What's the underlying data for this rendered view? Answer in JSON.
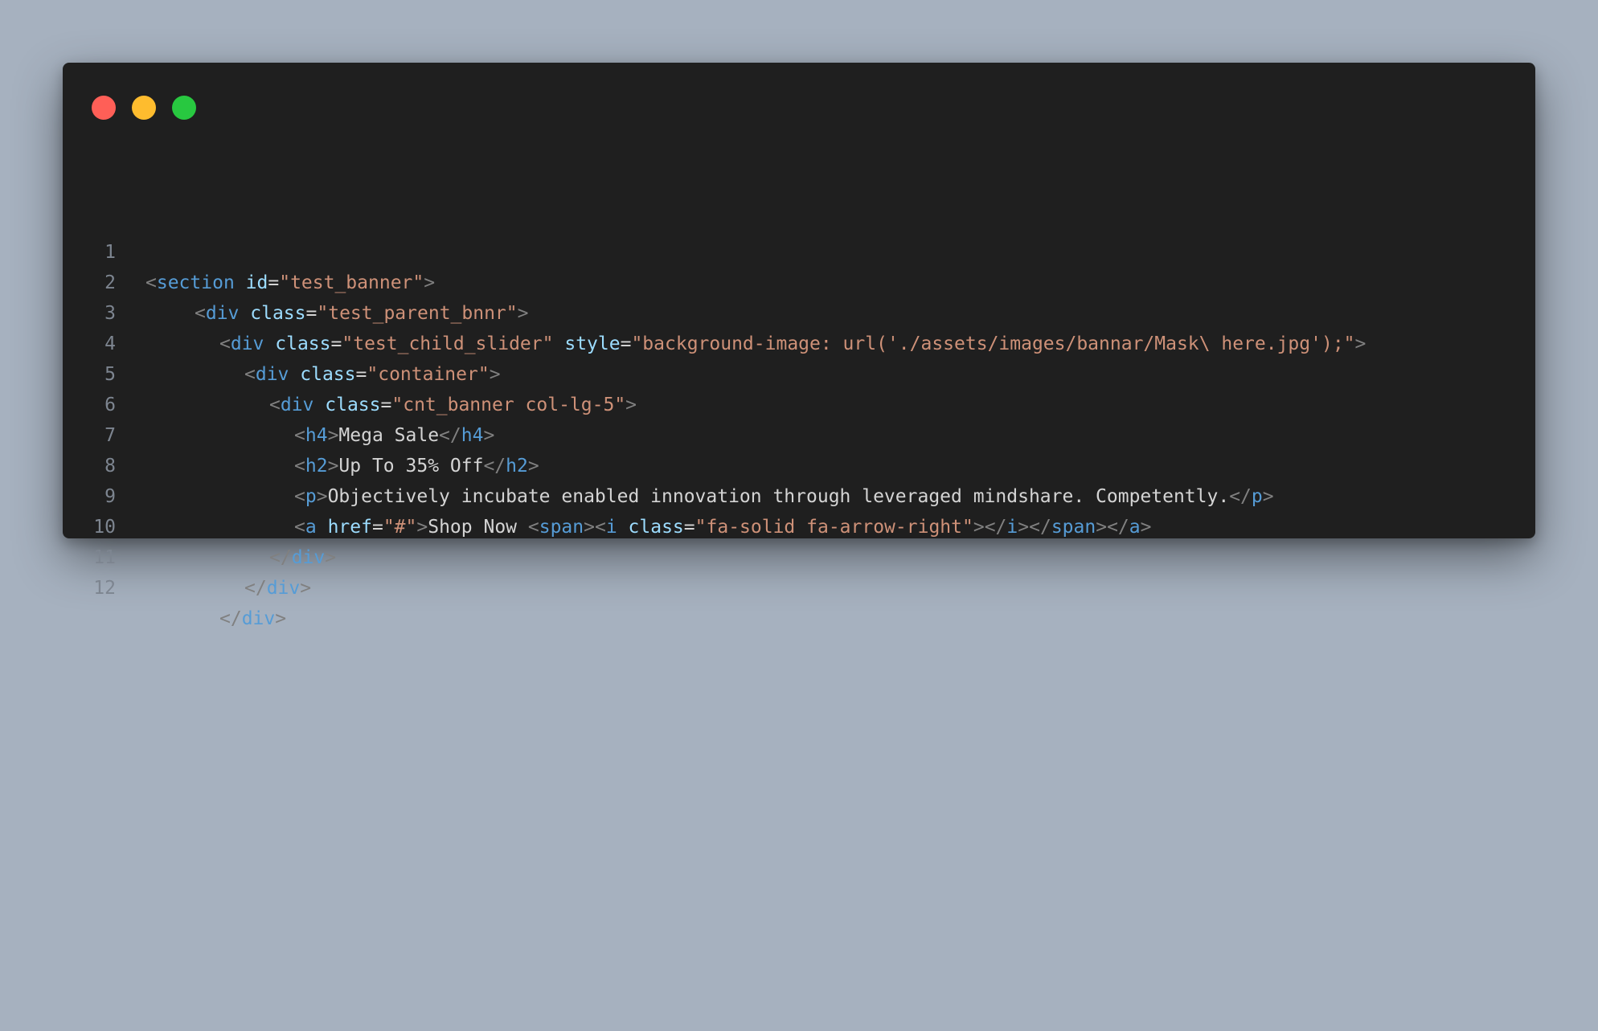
{
  "window": {
    "controls": [
      "close",
      "minimize",
      "maximize"
    ]
  },
  "colors": {
    "background": "#a6b1bf",
    "editor": "#1f1f1f",
    "tag": "#569cd6",
    "attribute": "#9cdcfe",
    "string": "#ce9178",
    "punctuation": "#808080",
    "text": "#d4d4d4",
    "line_number": "#7d8590"
  },
  "code": {
    "lines": [
      {
        "n": "1",
        "parts": [
          "<",
          "section",
          " ",
          "id",
          "=",
          "\"test_banner\"",
          ">"
        ]
      },
      {
        "n": "2",
        "parts": [
          "<",
          "div",
          " ",
          "class",
          "=",
          "\"test_parent_bnnr\"",
          ">"
        ]
      },
      {
        "n": "3",
        "parts": [
          "<",
          "div",
          " ",
          "class",
          "=",
          "\"test_child_slider\"",
          " ",
          "style",
          "=",
          "\"background-image: url('./assets/images/bannar/Mask\\ here.jpg');\"",
          ">"
        ]
      },
      {
        "n": "4",
        "parts": [
          "<",
          "div",
          " ",
          "class",
          "=",
          "\"container\"",
          ">"
        ]
      },
      {
        "n": "5",
        "parts": [
          "<",
          "div",
          " ",
          "class",
          "=",
          "\"cnt_banner col-lg-5\"",
          ">"
        ]
      },
      {
        "n": "6",
        "parts": [
          "<",
          "h4",
          ">",
          "Mega Sale",
          "</",
          "h4",
          ">"
        ]
      },
      {
        "n": "7",
        "parts": [
          "<",
          "h2",
          ">",
          "Up To 35% Off",
          "</",
          "h2",
          ">"
        ]
      },
      {
        "n": "8",
        "parts": [
          "<",
          "p",
          ">",
          "Objectively incubate enabled innovation through leveraged mindshare. Competently.",
          "</",
          "p",
          ">"
        ]
      },
      {
        "n": "9",
        "parts": [
          "<",
          "a",
          " ",
          "href",
          "=",
          "\"#\"",
          ">",
          "Shop Now ",
          "<",
          "span",
          ">",
          "<",
          "i",
          " ",
          "class",
          "=",
          "\"fa-solid fa-arrow-right\"",
          ">",
          "</",
          "i",
          ">",
          "</",
          "span",
          ">",
          "</",
          "a",
          ">"
        ]
      },
      {
        "n": "10",
        "parts": [
          "</",
          "div",
          ">"
        ]
      },
      {
        "n": "11",
        "parts": [
          "</",
          "div",
          ">"
        ]
      },
      {
        "n": "12",
        "parts": [
          "</",
          "div",
          ">"
        ]
      }
    ]
  }
}
